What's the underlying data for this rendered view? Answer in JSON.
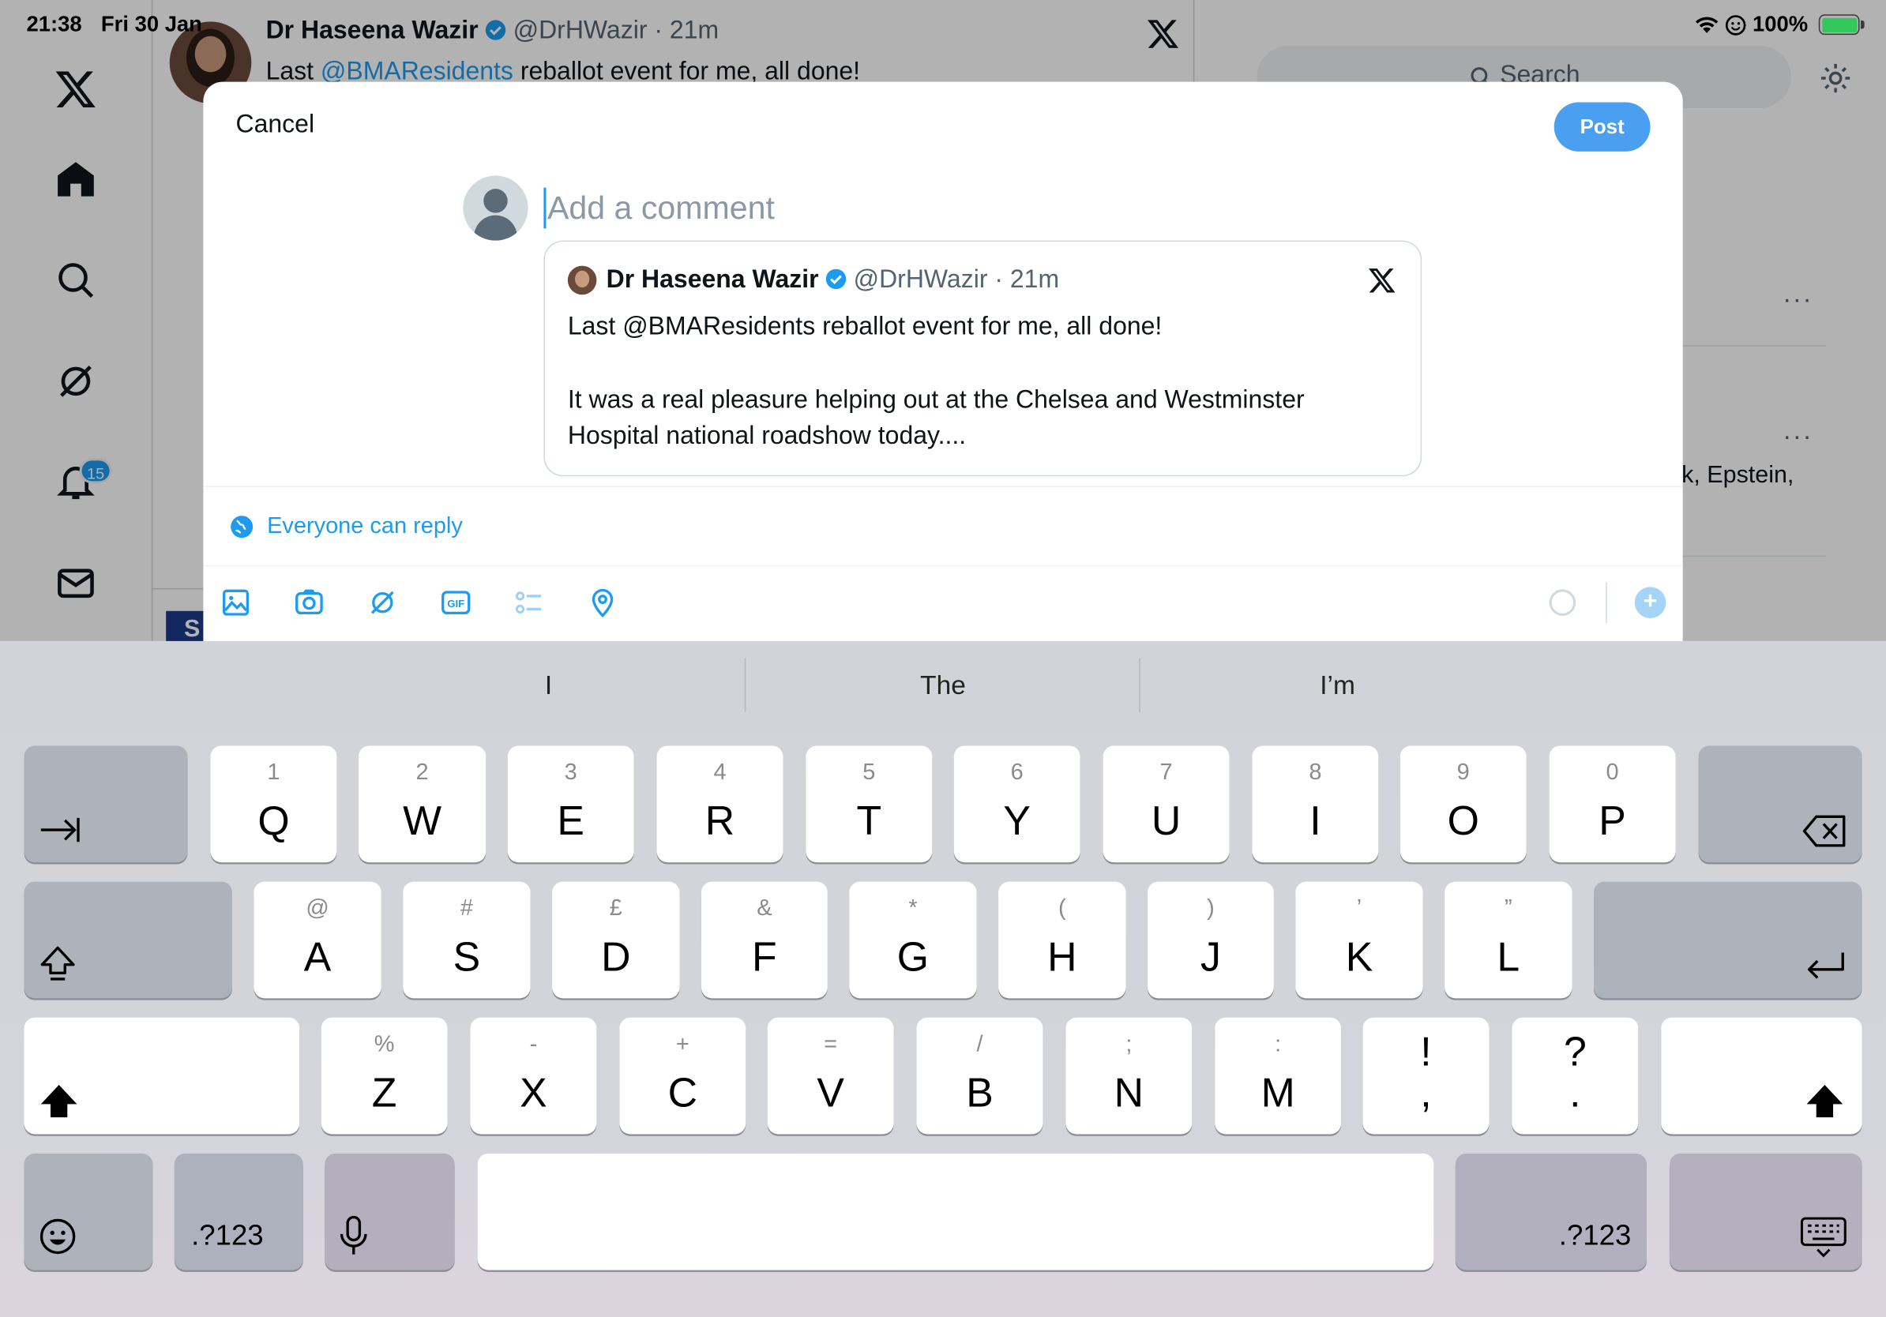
{
  "status_bar": {
    "time": "21:38",
    "date": "Fri 30 Jan",
    "battery": "100%"
  },
  "background": {
    "post_author": "Dr Haseena Wazir",
    "post_meta": "@DrHWazir · 21m",
    "post_text_prefix": "Last ",
    "post_mention": "@BMAResidents",
    "post_text_suffix": " reballot event for me, all done!",
    "search_placeholder": "Search",
    "notifications_count": "15",
    "trend_snippet": "k, Epstein,",
    "bottom_badge": "S"
  },
  "composer": {
    "cancel_label": "Cancel",
    "post_label": "Post",
    "placeholder": "Add a comment",
    "reply_setting": "Everyone can reply"
  },
  "quoted_post": {
    "author": "Dr Haseena Wazir",
    "meta": "@DrHWazir · 21m",
    "line1": "Last @BMAResidents reballot event for me, all done!",
    "line2": "It was a real pleasure helping out at the Chelsea and Westminster",
    "line3": "Hospital national roadshow today...."
  },
  "toolbar_icons": [
    "image-icon",
    "camera-icon",
    "grok-icon",
    "gif-icon",
    "poll-icon",
    "location-icon"
  ],
  "keyboard": {
    "suggestions": [
      "I",
      "The",
      "I’m"
    ],
    "row1": [
      {
        "key": "Q",
        "sub": "1"
      },
      {
        "key": "W",
        "sub": "2"
      },
      {
        "key": "E",
        "sub": "3"
      },
      {
        "key": "R",
        "sub": "4"
      },
      {
        "key": "T",
        "sub": "5"
      },
      {
        "key": "Y",
        "sub": "6"
      },
      {
        "key": "U",
        "sub": "7"
      },
      {
        "key": "I",
        "sub": "8"
      },
      {
        "key": "O",
        "sub": "9"
      },
      {
        "key": "P",
        "sub": "0"
      }
    ],
    "row2": [
      {
        "key": "A",
        "sub": "@"
      },
      {
        "key": "S",
        "sub": "#"
      },
      {
        "key": "D",
        "sub": "£"
      },
      {
        "key": "F",
        "sub": "&"
      },
      {
        "key": "G",
        "sub": "*"
      },
      {
        "key": "H",
        "sub": "("
      },
      {
        "key": "J",
        "sub": ")"
      },
      {
        "key": "K",
        "sub": "’"
      },
      {
        "key": "L",
        "sub": "”"
      }
    ],
    "row3": [
      {
        "key": "Z",
        "sub": "%"
      },
      {
        "key": "X",
        "sub": "-"
      },
      {
        "key": "C",
        "sub": "+"
      },
      {
        "key": "V",
        "sub": "="
      },
      {
        "key": "B",
        "sub": "/"
      },
      {
        "key": "N",
        "sub": ";"
      },
      {
        "key": "M",
        "sub": ":"
      },
      {
        "key": ",",
        "sub": "!"
      },
      {
        "key": ".",
        "sub": "?"
      }
    ],
    "numbers_label": ".?123"
  },
  "colors": {
    "accent": "#1d9bf0",
    "post_button": "#4a9ff0"
  }
}
